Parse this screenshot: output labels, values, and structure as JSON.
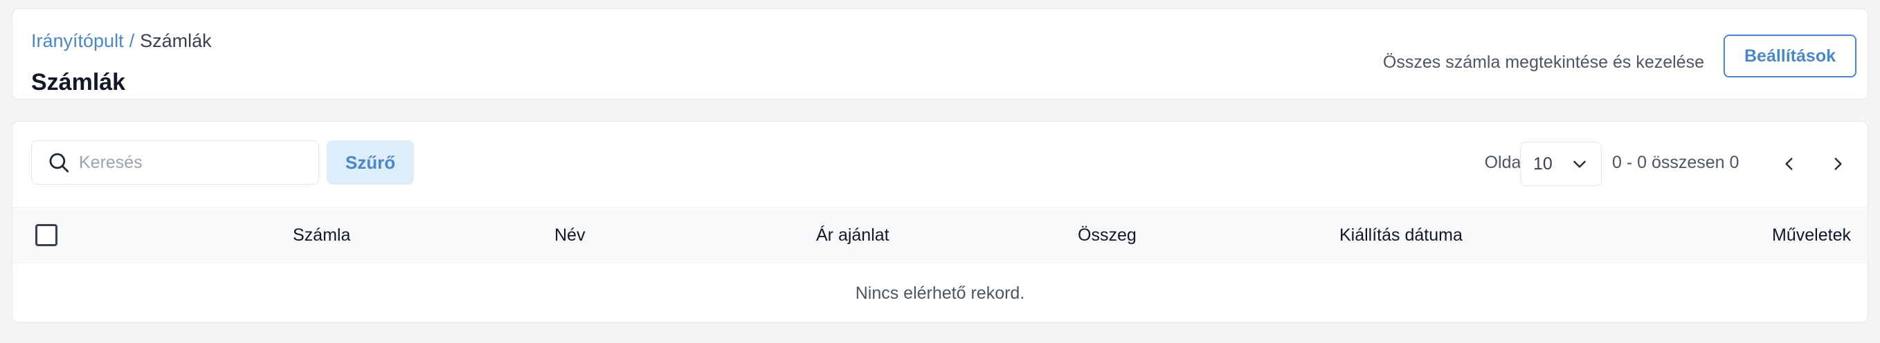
{
  "breadcrumb": {
    "home": "Irányítópult",
    "separator": "/",
    "current": "Számlák"
  },
  "header": {
    "title": "Számlák",
    "description": "Összes számla megtekintése és kezelése",
    "settings_label": "Beállítások"
  },
  "toolbar": {
    "search_placeholder": "Keresés",
    "search_value": "",
    "filter_label": "Szűrő",
    "per_page_label": "Oldalanként",
    "per_page_value": "10",
    "range_text": "0 - 0 összesen 0"
  },
  "table": {
    "columns": [
      "Számla",
      "Név",
      "Ár ajánlat",
      "Összeg",
      "Kiállítás dátuma",
      "Műveletek"
    ],
    "empty_message": "Nincs elérhető rekord."
  },
  "colors": {
    "accent": "#4b86c7",
    "accent_bg": "#deedfa",
    "page_bg": "#f3f4f6"
  },
  "icons": {
    "search": "search-icon",
    "dropdown": "chevron-down-icon",
    "prev": "chevron-left-icon",
    "next": "chevron-right-icon"
  }
}
